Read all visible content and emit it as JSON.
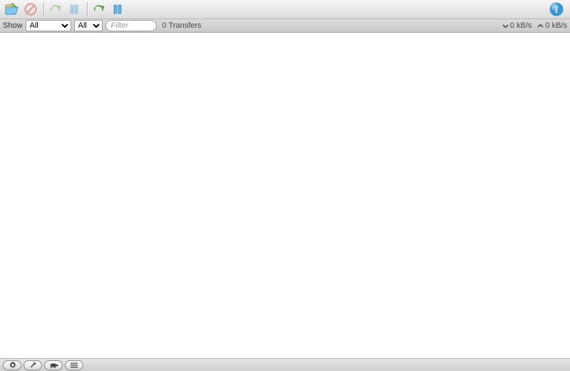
{
  "filterbar": {
    "show_label": "Show",
    "select1": "All",
    "select2": "All",
    "filter_placeholder": "Filter",
    "transfers_count": "0 Transfers",
    "down_speed": "0 kB/s",
    "up_speed": "0 kB/s"
  }
}
